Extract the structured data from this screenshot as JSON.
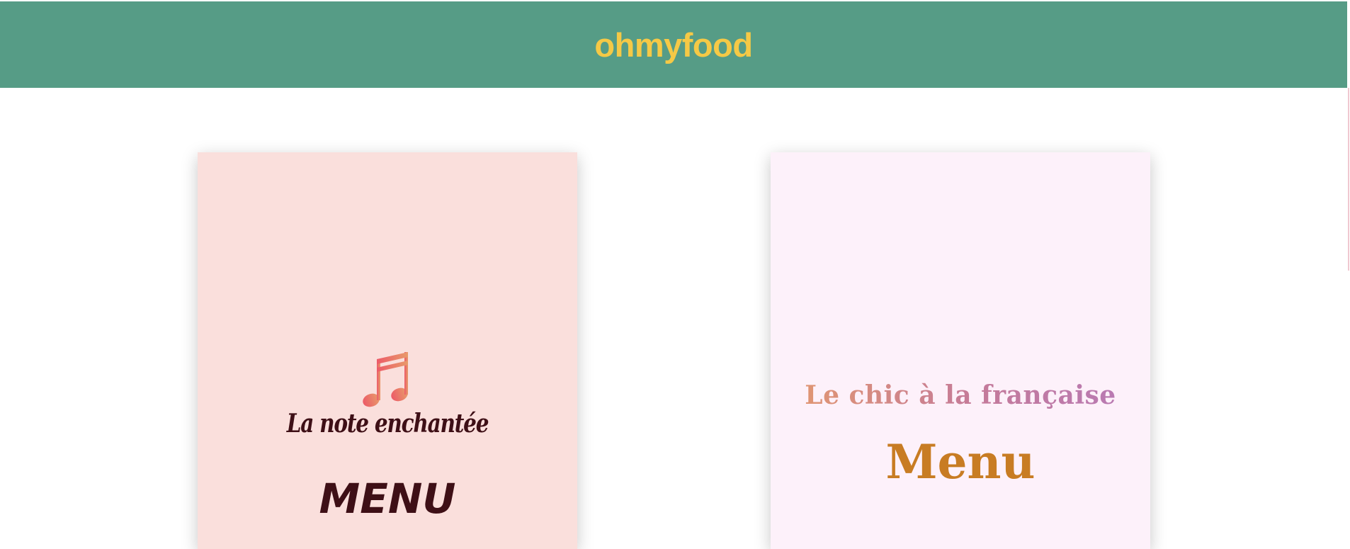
{
  "header": {
    "logo": "ohmyfood"
  },
  "cards": [
    {
      "icon": "music-note-icon",
      "title": "La note enchantée",
      "menu_label": "MENU"
    },
    {
      "title": "Le chic à la française",
      "menu_label": "Menu"
    }
  ],
  "colors": {
    "header_bg": "#569c86",
    "logo": "#f5c946",
    "card_left_bg": "#fadfdc",
    "card_right_bg": "#fdf1fa",
    "left_text": "#3e0f16",
    "right_menu": "#c87c23"
  }
}
